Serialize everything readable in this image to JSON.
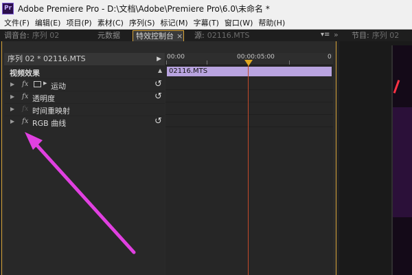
{
  "window": {
    "app_icon": "Pr",
    "title": "Adobe Premiere Pro - D:\\文档\\Adobe\\Premiere Pro\\6.0\\未命名 *"
  },
  "menubar": {
    "items": [
      "文件(F)",
      "编辑(E)",
      "项目(P)",
      "素材(C)",
      "序列(S)",
      "标记(M)",
      "字幕(T)",
      "窗口(W)",
      "帮助(H)"
    ]
  },
  "tabs": {
    "mixer": {
      "label": "调音台:",
      "sub": "序列 02"
    },
    "metadata": {
      "label": "元数据"
    },
    "effect_controls": {
      "label": "特效控制台",
      "close": "×"
    },
    "source": {
      "label": "源:",
      "sub": "02116.MTS"
    },
    "program": {
      "label": "节目:",
      "sub": "序列 02"
    }
  },
  "effect_controls": {
    "sequence_header": "序列 02 * 02116.MTS",
    "video_effects_label": "视频效果",
    "effects": [
      {
        "name": "运动",
        "fx": "fx",
        "resettable": true
      },
      {
        "name": "透明度",
        "fx": "fx",
        "resettable": true
      },
      {
        "name": "时间重映射",
        "fx": "fx",
        "resettable": false
      },
      {
        "name": "RGB 曲线",
        "fx": "fx",
        "resettable": true
      }
    ]
  },
  "timeline": {
    "start_tc": "00:00",
    "mid_tc": "00:00:05:00",
    "end_tc": "0",
    "clip_label": "02116.MTS"
  },
  "colors": {
    "accent_border": "#d9a53a",
    "clip_bar": "#b9a4e0",
    "playhead": "#c44a2a",
    "annotation_arrow": "#e040e0"
  }
}
